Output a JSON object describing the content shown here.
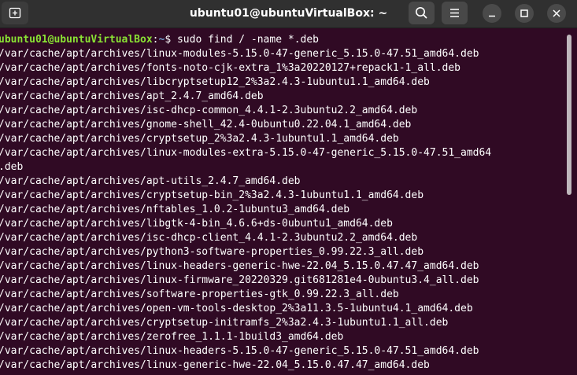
{
  "window": {
    "title": "ubuntu01@ubuntuVirtualBox: ~"
  },
  "icons": {
    "new_tab": "new-tab-icon",
    "search": "search-icon",
    "menu": "hamburger-menu-icon",
    "minimize": "minimize-icon",
    "maximize": "maximize-icon",
    "close": "close-icon"
  },
  "colors": {
    "terminal_background": "#300a24",
    "prompt_user": "#8ae234",
    "prompt_path": "#729fcf",
    "text": "#ffffff",
    "titlebar": "#303030"
  },
  "terminal": {
    "prompt": {
      "user_host": "ubuntu01@ubuntuVirtualBox",
      "separator": ":",
      "path": "~",
      "symbol": "$ ",
      "command": "sudo find / -name *.deb"
    },
    "output_lines": [
      "/var/cache/apt/archives/linux-modules-5.15.0-47-generic_5.15.0-47.51_amd64.deb",
      "/var/cache/apt/archives/fonts-noto-cjk-extra_1%3a20220127+repack1-1_all.deb",
      "/var/cache/apt/archives/libcryptsetup12_2%3a2.4.3-1ubuntu1.1_amd64.deb",
      "/var/cache/apt/archives/apt_2.4.7_amd64.deb",
      "/var/cache/apt/archives/isc-dhcp-common_4.4.1-2.3ubuntu2.2_amd64.deb",
      "/var/cache/apt/archives/gnome-shell_42.4-0ubuntu0.22.04.1_amd64.deb",
      "/var/cache/apt/archives/cryptsetup_2%3a2.4.3-1ubuntu1.1_amd64.deb",
      "/var/cache/apt/archives/linux-modules-extra-5.15.0-47-generic_5.15.0-47.51_amd64",
      ".deb",
      "/var/cache/apt/archives/apt-utils_2.4.7_amd64.deb",
      "/var/cache/apt/archives/cryptsetup-bin_2%3a2.4.3-1ubuntu1.1_amd64.deb",
      "/var/cache/apt/archives/nftables_1.0.2-1ubuntu3_amd64.deb",
      "/var/cache/apt/archives/libgtk-4-bin_4.6.6+ds-0ubuntu1_amd64.deb",
      "/var/cache/apt/archives/isc-dhcp-client_4.4.1-2.3ubuntu2.2_amd64.deb",
      "/var/cache/apt/archives/python3-software-properties_0.99.22.3_all.deb",
      "/var/cache/apt/archives/linux-headers-generic-hwe-22.04_5.15.0.47.47_amd64.deb",
      "/var/cache/apt/archives/linux-firmware_20220329.git681281e4-0ubuntu3.4_all.deb",
      "/var/cache/apt/archives/software-properties-gtk_0.99.22.3_all.deb",
      "/var/cache/apt/archives/open-vm-tools-desktop_2%3a11.3.5-1ubuntu4.1_amd64.deb",
      "/var/cache/apt/archives/cryptsetup-initramfs_2%3a2.4.3-1ubuntu1.1_all.deb",
      "/var/cache/apt/archives/zerofree_1.1.1-1build3_amd64.deb",
      "/var/cache/apt/archives/linux-headers-5.15.0-47-generic_5.15.0-47.51_amd64.deb",
      "/var/cache/apt/archives/linux-generic-hwe-22.04_5.15.0.47.47_amd64.deb"
    ]
  }
}
